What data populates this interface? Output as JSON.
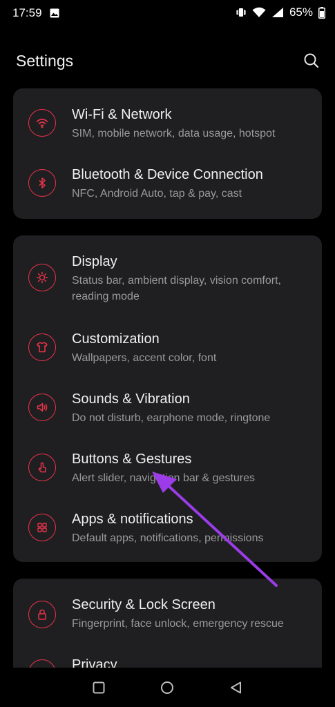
{
  "status_bar": {
    "time": "17:59",
    "battery": "65%",
    "icons": [
      "gallery-icon",
      "vibrate-icon",
      "wifi-icon",
      "signal-icon",
      "battery-icon"
    ]
  },
  "header": {
    "title": "Settings",
    "search_icon": "search-icon"
  },
  "colors": {
    "accent": "#e8334a",
    "card_bg": "#1f1f21",
    "background": "#000000",
    "annotation_arrow": "#9b3ce8"
  },
  "groups": [
    {
      "items": [
        {
          "title": "Wi-Fi & Network",
          "subtitle": "SIM, mobile network, data usage, hotspot",
          "icon": "wifi-icon"
        },
        {
          "title": "Bluetooth & Device Connection",
          "subtitle": "NFC, Android Auto, tap & pay, cast",
          "icon": "bluetooth-icon"
        }
      ]
    },
    {
      "items": [
        {
          "title": "Display",
          "subtitle": "Status bar, ambient display, vision comfort, reading mode",
          "icon": "brightness-icon"
        },
        {
          "title": "Customization",
          "subtitle": "Wallpapers, accent color, font",
          "icon": "tshirt-icon"
        },
        {
          "title": "Sounds & Vibration",
          "subtitle": "Do not disturb, earphone mode, ringtone",
          "icon": "speaker-icon"
        },
        {
          "title": "Buttons & Gestures",
          "subtitle": "Alert slider, navigation bar & gestures",
          "icon": "gesture-icon"
        },
        {
          "title": "Apps & notifications",
          "subtitle": "Default apps, notifications, permissions",
          "icon": "apps-grid-icon"
        }
      ]
    },
    {
      "items": [
        {
          "title": "Security & Lock Screen",
          "subtitle": "Fingerprint, face unlock, emergency rescue",
          "icon": "lock-icon"
        },
        {
          "title": "Privacy",
          "subtitle": "",
          "icon": "privacy-icon"
        }
      ]
    }
  ],
  "nav_bar": {
    "buttons": [
      "recent-apps-icon",
      "home-icon",
      "back-icon"
    ]
  }
}
